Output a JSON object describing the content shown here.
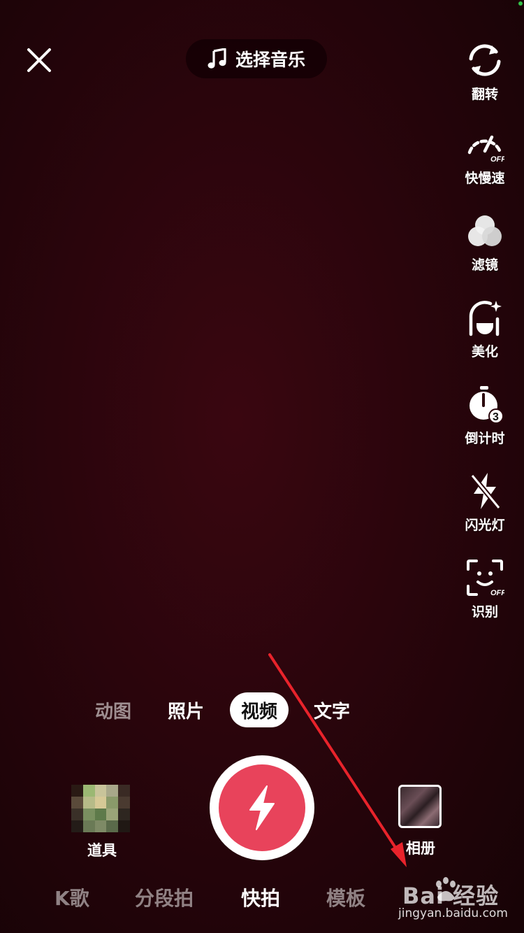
{
  "top": {
    "music_label": "选择音乐"
  },
  "right_rail": [
    {
      "label": "翻转",
      "icon": "flip-camera-icon"
    },
    {
      "label": "快慢速",
      "icon": "speed-gauge-icon",
      "badge": "OFF"
    },
    {
      "label": "滤镜",
      "icon": "filter-icon"
    },
    {
      "label": "美化",
      "icon": "beauty-icon"
    },
    {
      "label": "倒计时",
      "icon": "timer-icon",
      "badge": "3"
    },
    {
      "label": "闪光灯",
      "icon": "flash-off-icon"
    },
    {
      "label": "识别",
      "icon": "face-detect-icon",
      "badge": "OFF"
    }
  ],
  "modes": [
    "动图",
    "照片",
    "视频",
    "文字"
  ],
  "active_mode": "视频",
  "props_label": "道具",
  "album_label": "相册",
  "bottom_tabs": [
    "K歌",
    "分段拍",
    "快拍",
    "模板"
  ],
  "active_tab": "快拍",
  "watermark": {
    "brand": "Bai 经验",
    "url": "jingyan.baidu.com"
  },
  "colors": {
    "shutter": "#e8435b",
    "annotation_arrow": "#e8232b",
    "background": "#2a050c"
  }
}
